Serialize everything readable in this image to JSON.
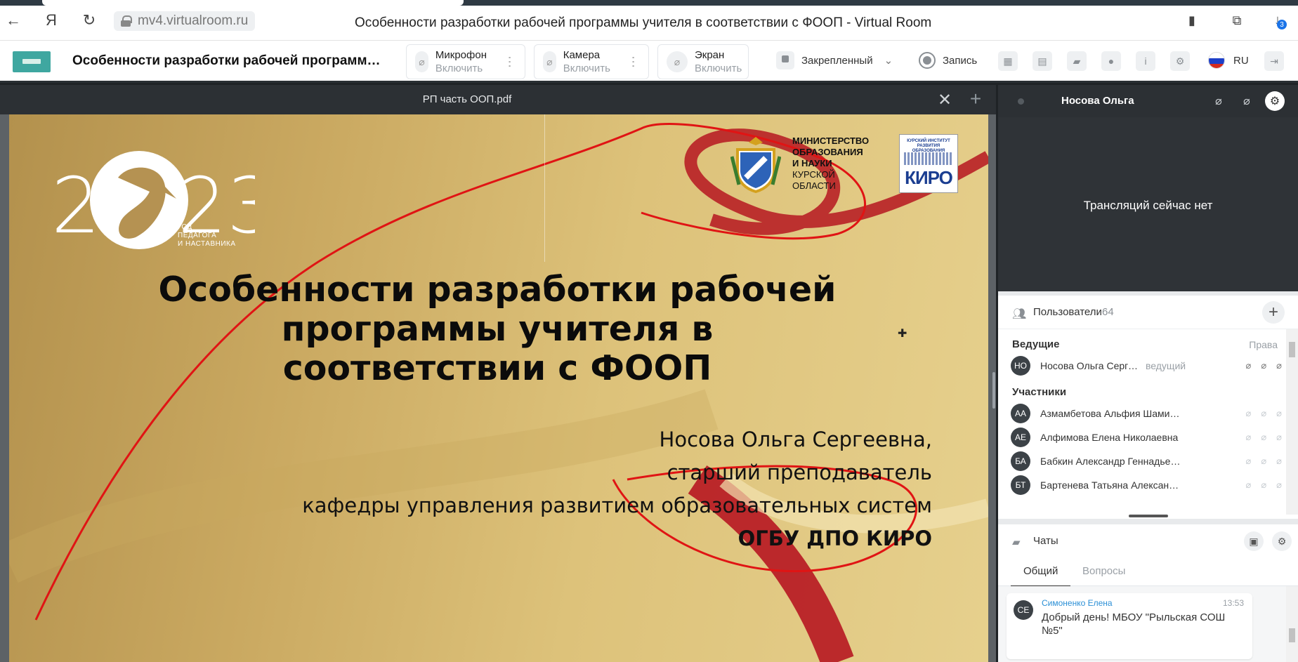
{
  "browser": {
    "url": "mv4.virtualroom.ru",
    "page_title": "Особенности разработки рабочей программы учителя в соответствии с ФООП - Virtual Room",
    "downloads_badge": "3"
  },
  "app": {
    "title": "Особенности разработки рабочей программы учит...",
    "mic": {
      "label": "Микрофон",
      "action": "Включить"
    },
    "camera": {
      "label": "Камера",
      "action": "Включить"
    },
    "screen": {
      "label": "Экран",
      "action": "Включить"
    },
    "pinned": "Закрепленный",
    "record": "Запись",
    "language": "RU"
  },
  "document": {
    "filename": "РП часть ООП.pdf"
  },
  "slide": {
    "year_caption": [
      "ГОД",
      "ПЕДАГОГА",
      "И НАСТАВНИКА"
    ],
    "ministry": [
      "МИНИСТЕРСТВО",
      "ОБРАЗОВАНИЯ",
      "И НАУКИ",
      "КУРСКОЙ",
      "ОБЛАСТИ"
    ],
    "kiro_small": "КУРСКИЙ ИНСТИТУТ РАЗВИТИЯ ОБРАЗОВАНИЯ",
    "kiro_big": "КИРО",
    "headline": [
      "Особенности разработки рабочей",
      "программы учителя в",
      "соответствии с ФООП"
    ],
    "author": [
      "Носова Ольга Сергеевна,",
      "старший преподаватель",
      "кафедры управления развитием образовательных систем",
      "ОГБУ ДПО КИРО"
    ]
  },
  "video": {
    "presenter": "Носова Ольга",
    "empty_text": "Трансляций сейчас нет"
  },
  "users": {
    "label": "Пользователи",
    "count": "64",
    "hosts_label": "Ведущие",
    "rights_label": "Права",
    "hosts": [
      {
        "initials": "НО",
        "name": "Носова Ольга Сергее...",
        "role": "ведущий"
      }
    ],
    "participants_label": "Участники",
    "participants": [
      {
        "initials": "АА",
        "name": "Азмамбетова Альфия Шамилье..."
      },
      {
        "initials": "АЕ",
        "name": "Алфимова Елена Николаевна"
      },
      {
        "initials": "БА",
        "name": "Бабкин Александр Геннадьевич"
      },
      {
        "initials": "БТ",
        "name": "Бартенева Татьяна Александров..."
      }
    ]
  },
  "chat": {
    "label": "Чаты",
    "tabs": [
      "Общий",
      "Вопросы"
    ],
    "messages": [
      {
        "initials": "СЕ",
        "author": "Симоненко Елена",
        "time": "13:53",
        "text": "Добрый день! МБОУ \"Рыльская СОШ №5\""
      }
    ]
  }
}
